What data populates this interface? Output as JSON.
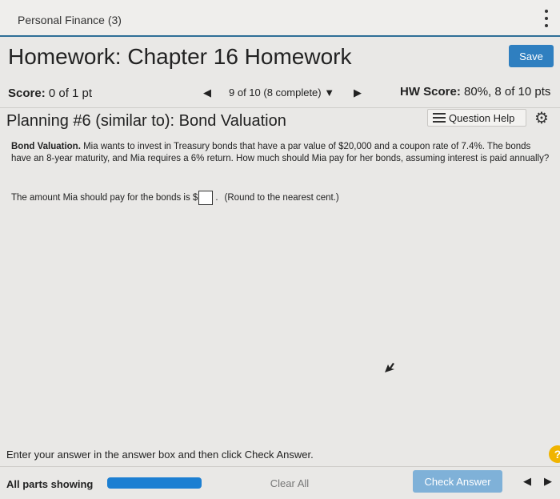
{
  "header": {
    "course_title": "Personal Finance (3)",
    "homework_title": "Homework: Chapter 16 Homework",
    "save_label": "Save"
  },
  "score_row": {
    "score_label": "Score:",
    "score_value": "0 of 1 pt",
    "prev_glyph": "◀",
    "progress_text": "9 of 10 (8 complete) ▼",
    "next_glyph": "▶",
    "hw_score_label": "HW Score:",
    "hw_score_value": "80%, 8 of 10 pts"
  },
  "question": {
    "title": "Planning #6 (similar to): Bond Valuation",
    "help_label": "Question Help",
    "problem_lead": "Bond Valuation.",
    "problem_text": "Mia wants to invest in Treasury bonds that have a par value of $20,000 and a coupon rate of 7.4%. The bonds have an 8-year maturity, and Mia requires a 6% return. How much should Mia pay for her bonds, assuming interest is paid annually?",
    "answer_prefix": "The amount Mia should pay for the bonds is $",
    "answer_value": "",
    "answer_suffix_dot": ".",
    "answer_hint": "(Round to the nearest cent.)"
  },
  "footer": {
    "instruction": "Enter your answer in the answer box and then click Check Answer.",
    "parts_label": "All parts showing",
    "clear_label": "Clear All",
    "check_label": "Check Answer",
    "help_glyph": "?",
    "prev_glyph": "◀",
    "next_glyph": "▶"
  },
  "colors": {
    "save_button": "#2f7fc0",
    "check_button": "#7fb1d8",
    "progress_fill": "#1c7fd2",
    "help_circle": "#f0b400"
  },
  "icons": {
    "menu": "kebab-vertical-icon",
    "question_help": "list-icon",
    "settings": "gear-icon"
  }
}
